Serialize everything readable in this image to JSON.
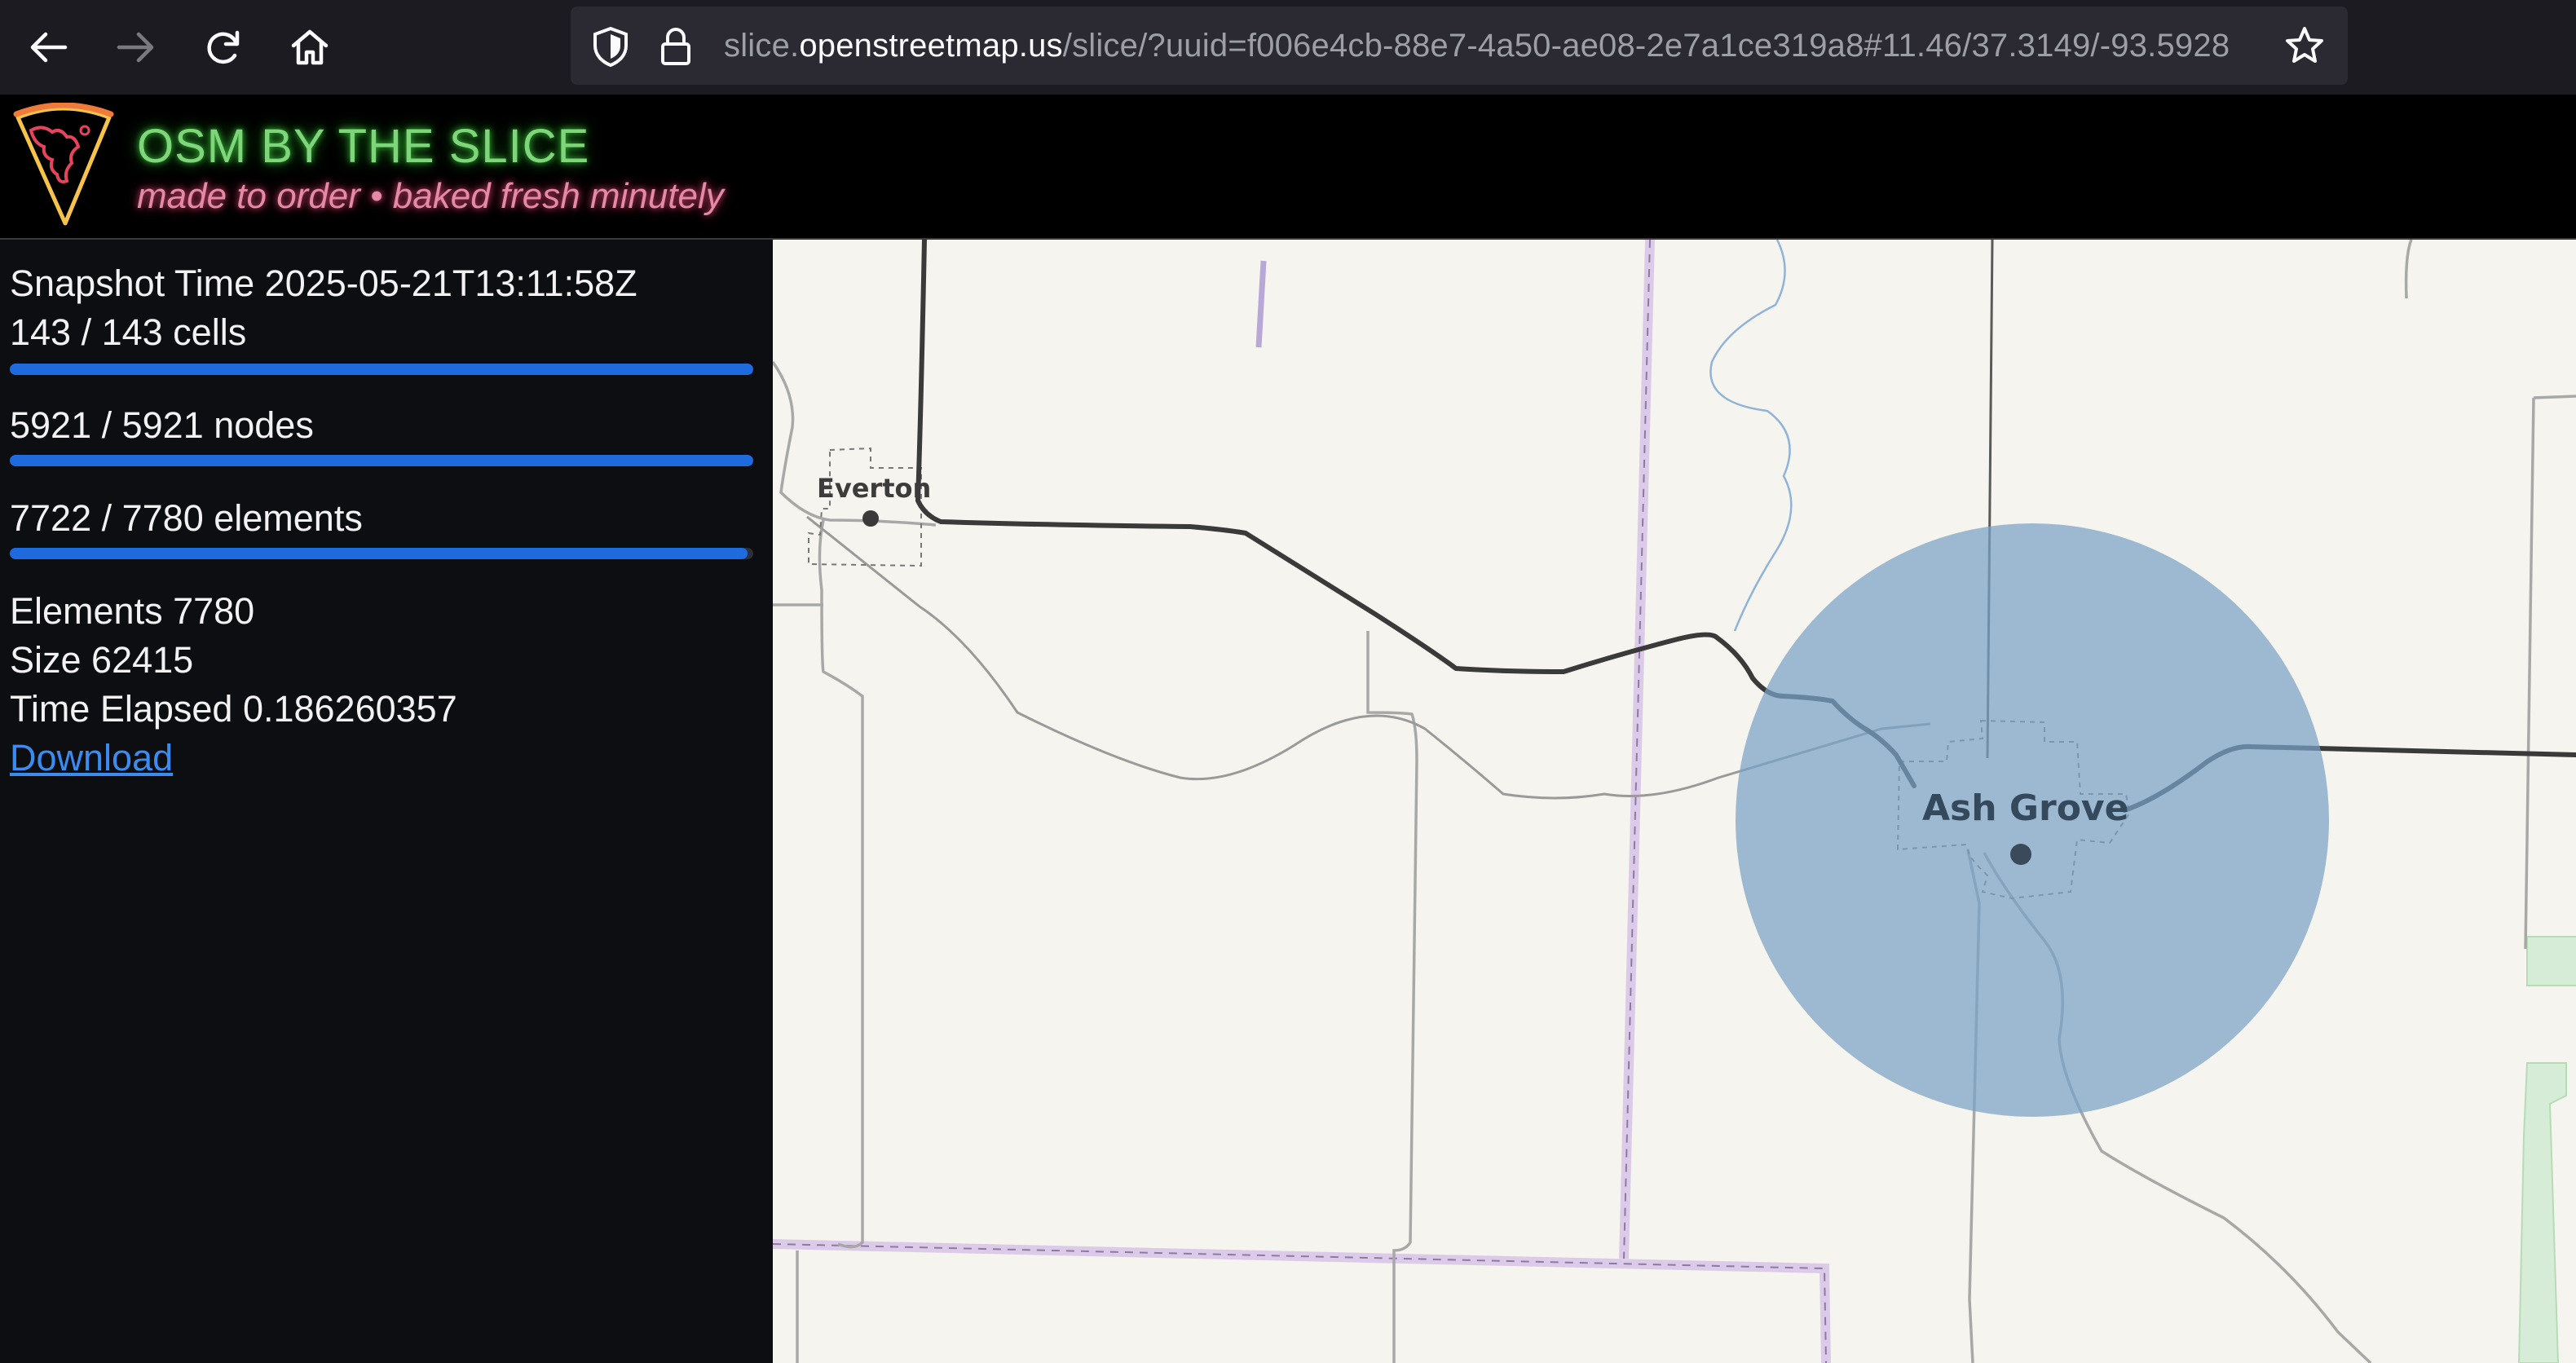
{
  "browser": {
    "url_host_prefix": "slice.",
    "url_host": "openstreetmap.us",
    "url_path": "/slice/?uuid=f006e4cb-88e7-4a50-ae08-2e7a1ce319a8#11.46/37.3149/-93.5928",
    "icons": [
      "back-arrow-icon",
      "forward-arrow-icon",
      "reload-icon",
      "home-icon",
      "shield-icon",
      "lock-icon",
      "star-icon"
    ]
  },
  "header": {
    "title": "OSM BY THE SLICE",
    "tagline": "made to order • baked fresh minutely",
    "colors": {
      "title": "#7fd67a",
      "tagline": "#e58aa6"
    }
  },
  "sidebar": {
    "snapshot_time": "Snapshot Time 2025-05-21T13:11:58Z",
    "progress": [
      {
        "label": "143 / 143 cells",
        "fraction": 1.0
      },
      {
        "label": "5921 / 5921 nodes",
        "fraction": 1.0
      },
      {
        "label": "7722 / 7780 elements",
        "fraction": 0.9925
      }
    ],
    "elements": "Elements 7780",
    "size": "Size 62415",
    "time_elapsed": "Time Elapsed 0.186260357",
    "download_label": "Download",
    "accent": "#1e6be0"
  },
  "map": {
    "places": [
      {
        "name": "Everton"
      },
      {
        "name": "Ash Grove"
      }
    ],
    "colors": {
      "background": "#f6f4ee",
      "highlight_circle": "#8fb0cc",
      "primary_road": "#3a3a3a",
      "minor_road": "#a8a8a8",
      "boundary": "#cbb8dd",
      "water": "#8fb3d9",
      "park": "#d6ecd6"
    }
  }
}
